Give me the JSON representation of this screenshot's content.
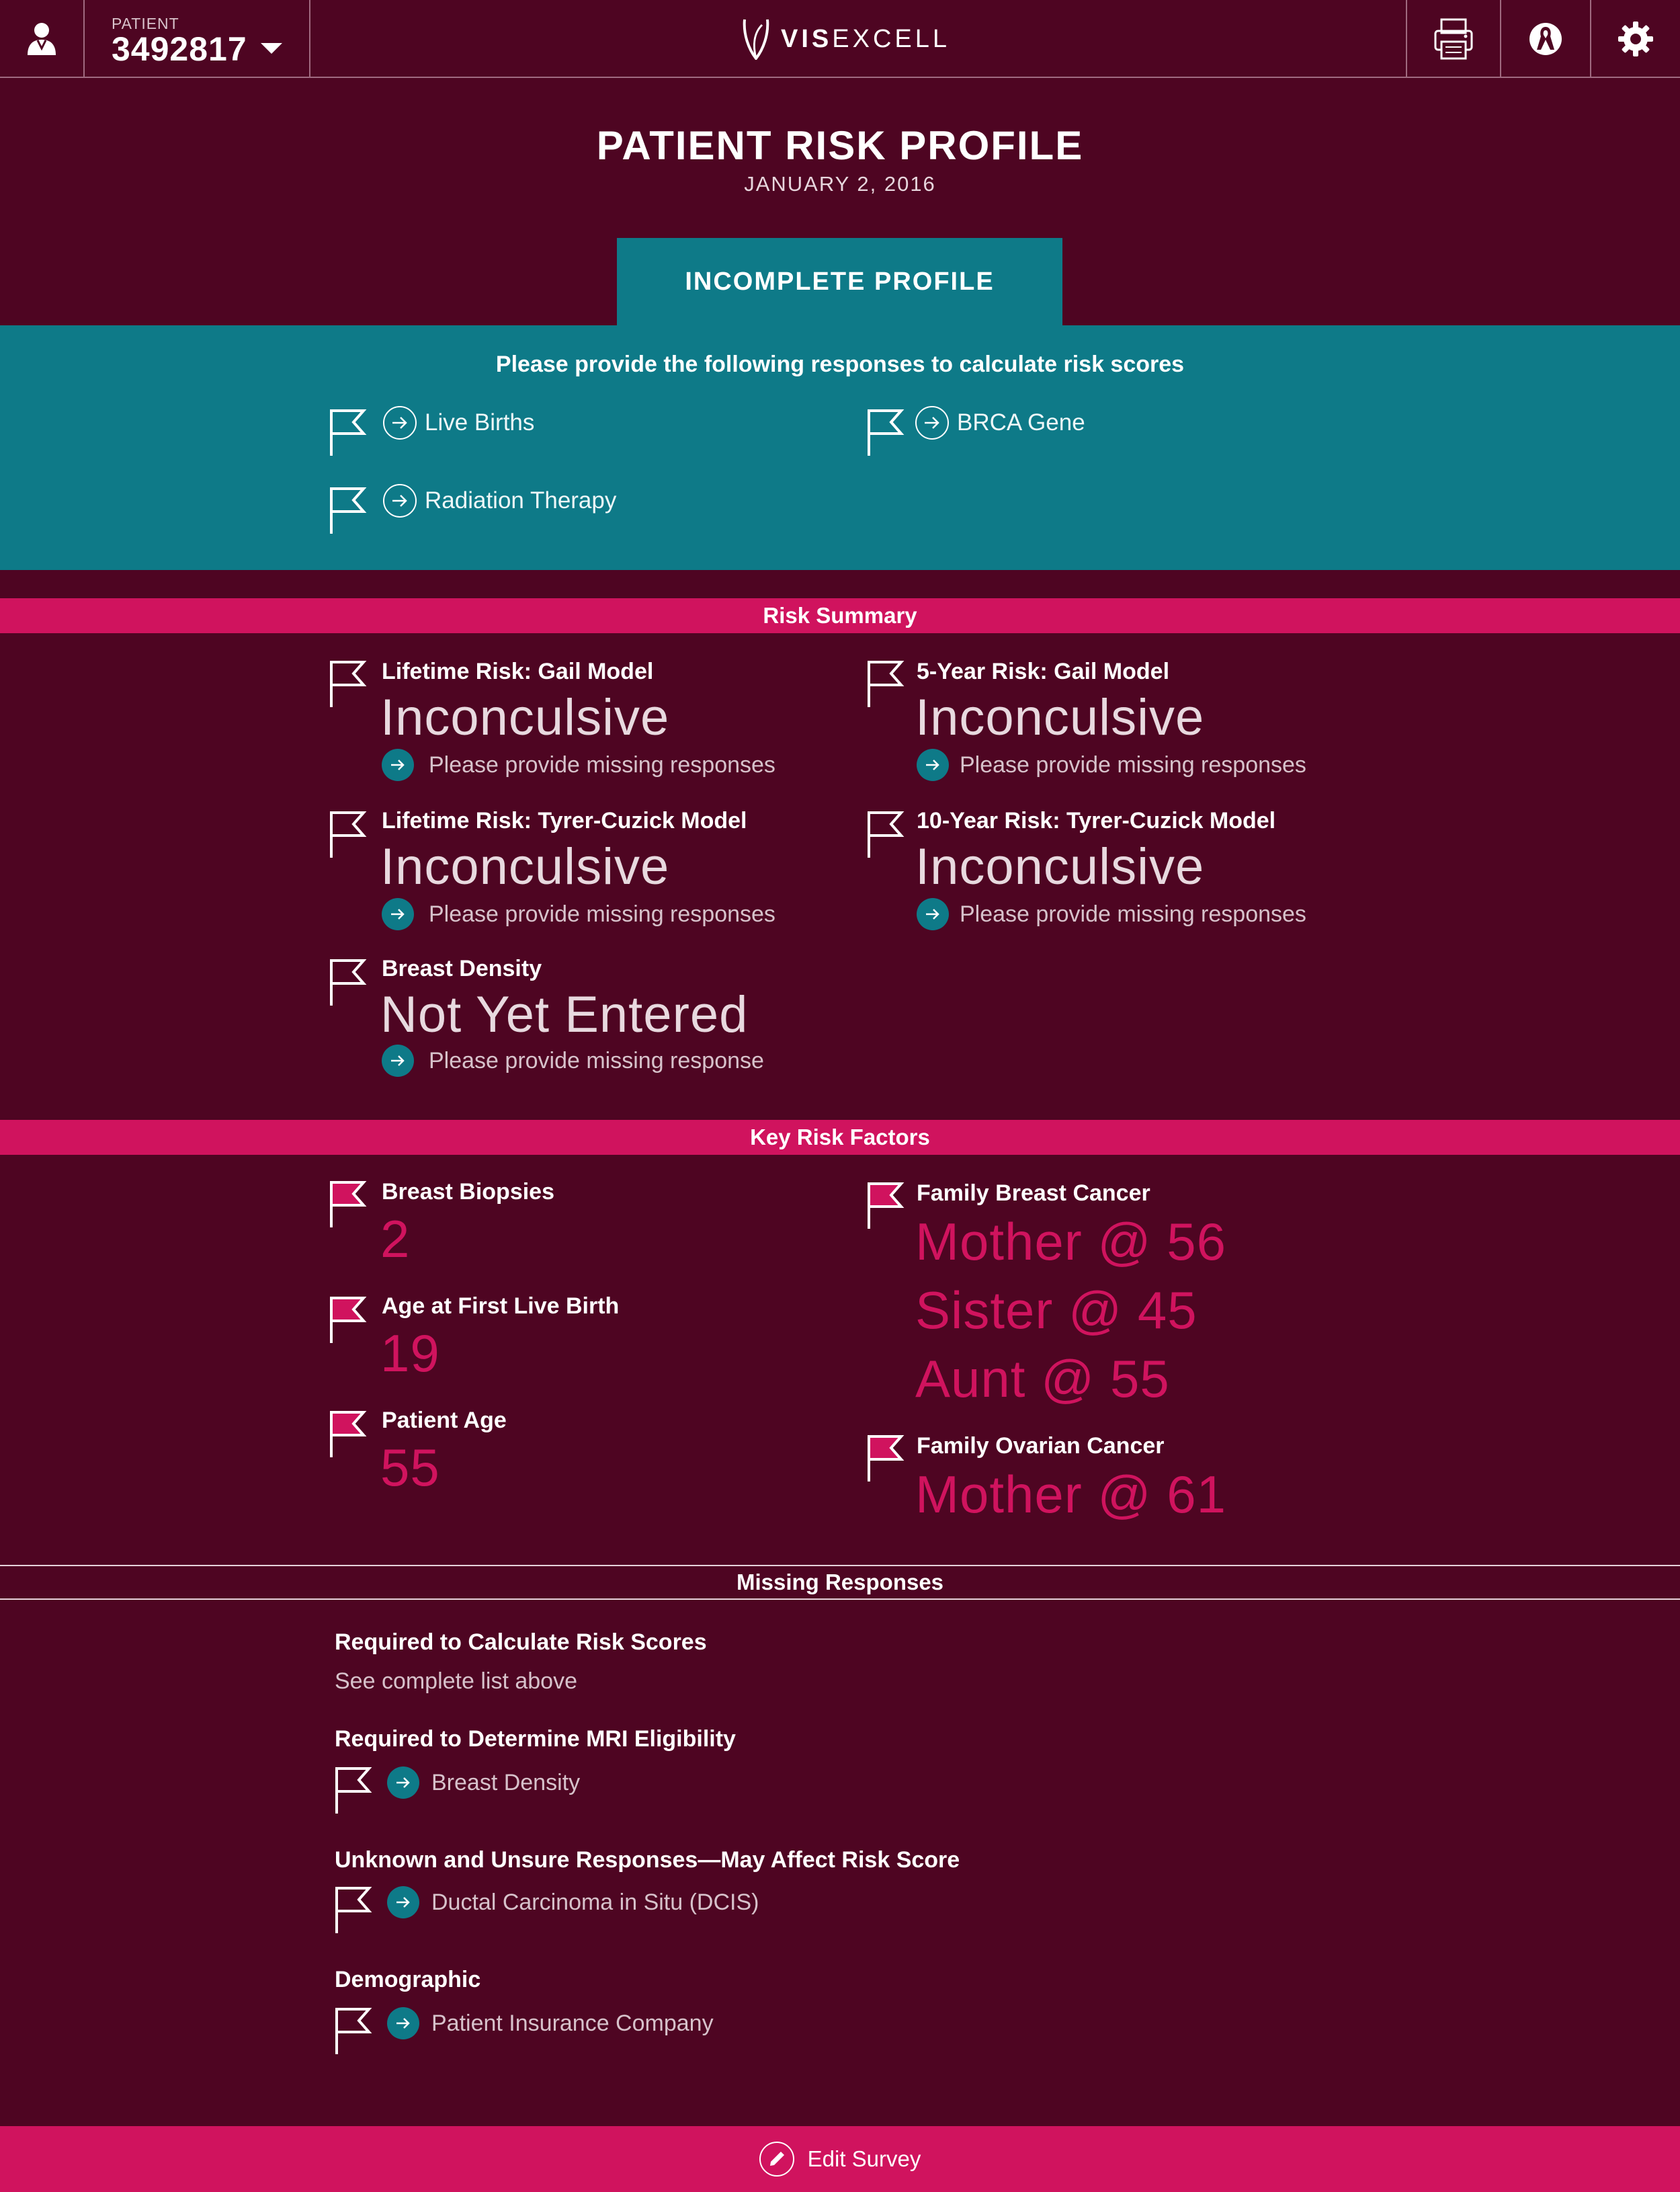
{
  "header": {
    "patient_label": "PATIENT",
    "patient_id": "3492817",
    "brand_bold": "VIS",
    "brand_light": "EXCELL",
    "icons": [
      "user-icon",
      "printer-icon",
      "ribbon-icon",
      "gear-icon"
    ]
  },
  "page": {
    "title": "PATIENT RISK PROFILE",
    "date": "JANUARY 2, 2016"
  },
  "incomplete": {
    "tab_label": "INCOMPLETE PROFILE",
    "message": "Please provide the following responses to calculate risk scores",
    "items": [
      "Live Births",
      "BRCA Gene",
      "Radiation Therapy"
    ]
  },
  "risk_summary": {
    "title": "Risk Summary",
    "items": [
      {
        "label": "Lifetime Risk: Gail Model",
        "value": "Inconculsive",
        "hint": "Please provide missing responses"
      },
      {
        "label": "5-Year Risk: Gail Model",
        "value": "Inconculsive",
        "hint": "Please provide missing responses"
      },
      {
        "label": "Lifetime Risk: Tyrer-Cuzick Model",
        "value": "Inconculsive",
        "hint": "Please provide missing responses"
      },
      {
        "label": "10-Year Risk: Tyrer-Cuzick Model",
        "value": "Inconculsive",
        "hint": "Please provide missing responses"
      },
      {
        "label": "Breast Density",
        "value": "Not Yet Entered",
        "hint": "Please provide missing response"
      }
    ]
  },
  "key_factors": {
    "title": "Key Risk Factors",
    "biopsies": {
      "label": "Breast Biopsies",
      "value": "2"
    },
    "first_birth": {
      "label": "Age at First Live Birth",
      "value": "19"
    },
    "patient_age": {
      "label": "Patient Age",
      "value": "55"
    },
    "family_breast": {
      "label": "Family Breast Cancer",
      "values": [
        "Mother @ 56",
        "Sister @ 45",
        "Aunt @ 55"
      ]
    },
    "family_ovarian": {
      "label": "Family Ovarian Cancer",
      "value": "Mother @ 61"
    }
  },
  "missing": {
    "title": "Missing Responses",
    "groups": [
      {
        "heading": "Required to Calculate Risk Scores",
        "sub": "See complete list above"
      },
      {
        "heading": "Required to Determine MRI Eligibility",
        "item": "Breast Density"
      },
      {
        "heading": "Unknown and Unsure Responses—May Affect Risk Score",
        "item": "Ductal Carcinoma in Situ (DCIS)"
      },
      {
        "heading": "Demographic",
        "item": "Patient Insurance Company"
      }
    ]
  },
  "footer": {
    "edit_label": "Edit Survey"
  },
  "colors": {
    "background": "#4e0522",
    "teal": "#0e7a88",
    "magenta": "#d0135e"
  }
}
